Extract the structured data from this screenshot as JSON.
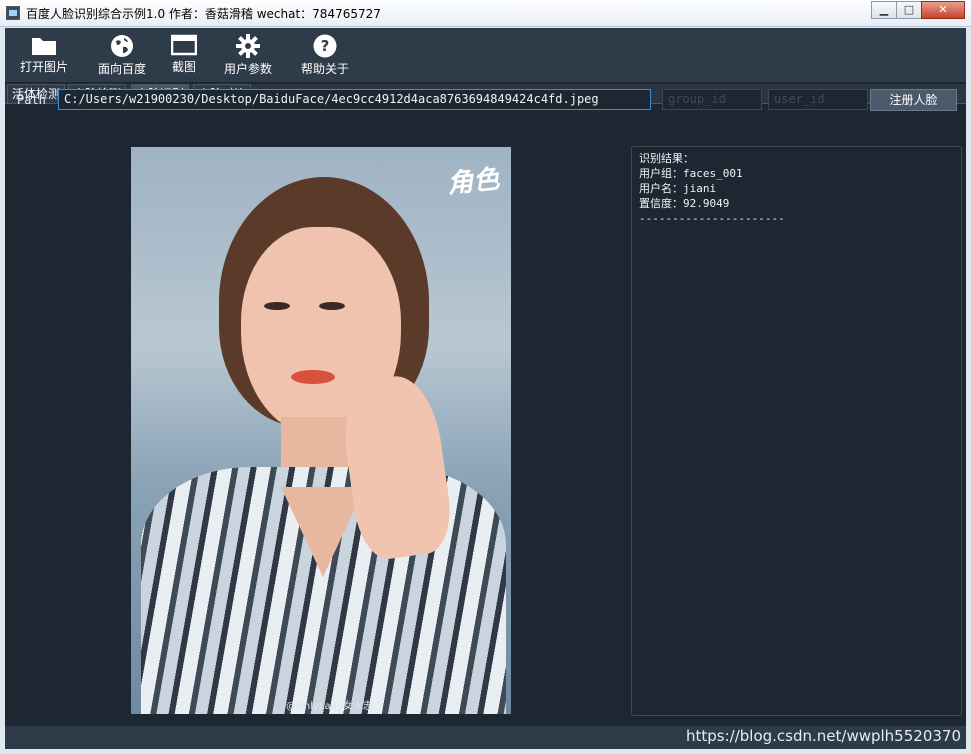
{
  "window": {
    "title": "百度人脸识别综合示例1.0 作者：香菇滑稽 wechat：784765727"
  },
  "toolbar": {
    "items": [
      {
        "label": "打开图片",
        "icon": "folder-icon"
      },
      {
        "label": "面向百度",
        "icon": "globe-icon"
      },
      {
        "label": "截图",
        "icon": "window-icon"
      },
      {
        "label": "用户参数",
        "icon": "gear-icon"
      },
      {
        "label": "帮助关于",
        "icon": "help-icon"
      }
    ]
  },
  "tabs": [
    {
      "label": "活体检测",
      "active": false
    },
    {
      "label": "人脸检测",
      "active": false
    },
    {
      "label": "人脸识别",
      "active": true
    },
    {
      "label": "人脸对比",
      "active": false
    }
  ],
  "form": {
    "path_label": "Path",
    "path_value": "C:/Users/w21900230/Desktop/BaiduFace/4ec9cc4912d4aca8763694849424c4fd.jpeg",
    "group_placeholder": "group_id",
    "user_placeholder": "user_id",
    "register_label": "注册人脸"
  },
  "image": {
    "logo_text": "角色",
    "watermark": "@OnlyLady女人志"
  },
  "result": {
    "lines": [
      "识别结果：",
      "用户组：faces_001",
      "用户名：jiani",
      "置信度：92.9049",
      "----------------------"
    ]
  },
  "footer": {
    "watermark": "https://blog.csdn.net/wwplh5520370"
  },
  "colors": {
    "background": "#1d2731",
    "toolbar": "#2e3b48",
    "accent_border": "#3a8fd6"
  }
}
